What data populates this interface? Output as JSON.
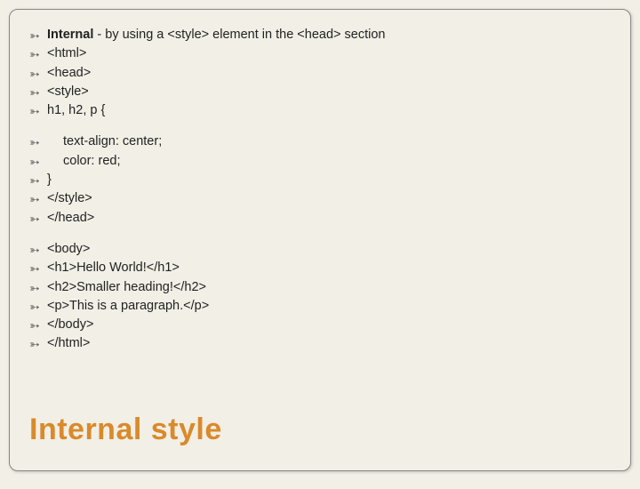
{
  "slide": {
    "group1": [
      {
        "bold": "Internal",
        "rest": " - by using a <style> element in the <head> section"
      },
      {
        "text": "<html>"
      },
      {
        "text": "<head>"
      },
      {
        "text": "<style>"
      },
      {
        "text": "h1, h2, p {"
      }
    ],
    "group2": [
      {
        "text": "text-align: center;",
        "indent": true
      },
      {
        "text": "color: red;",
        "indent": true
      },
      {
        "text": "}"
      },
      {
        "text": "</style>"
      },
      {
        "text": "</head>"
      }
    ],
    "group3": [
      {
        "text": "<body>"
      },
      {
        "text": "<h1>Hello World!</h1>"
      },
      {
        "text": "<h2>Smaller heading!</h2>"
      },
      {
        "text": "<p>This is a paragraph.</p>"
      },
      {
        "text": "</body>"
      },
      {
        "text": "</html>"
      }
    ],
    "title": "Internal style"
  }
}
